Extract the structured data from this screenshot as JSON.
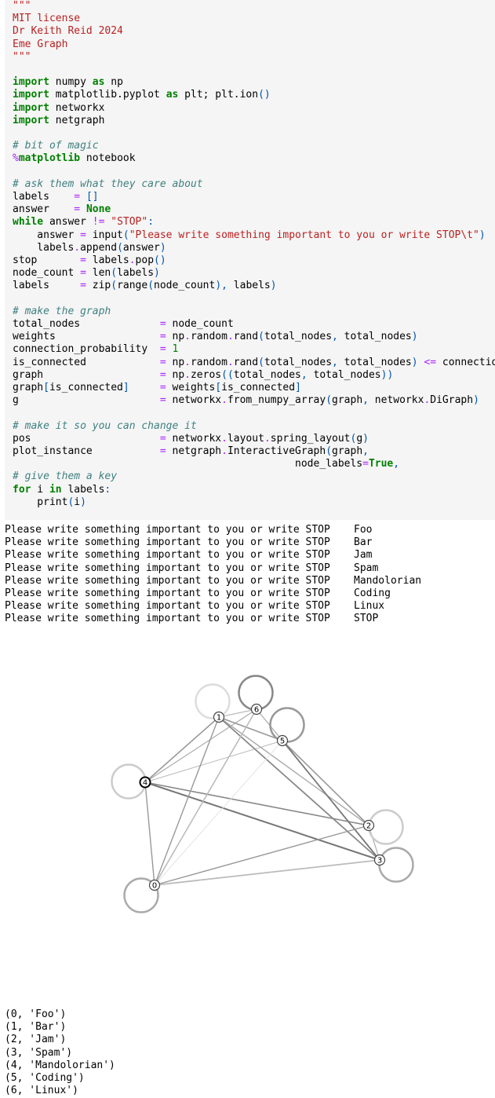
{
  "code_lines": [
    [
      {
        "t": "\"\"\"",
        "c": "str"
      }
    ],
    [
      {
        "t": "MIT license",
        "c": "str"
      }
    ],
    [
      {
        "t": "Dr Keith Reid 2024",
        "c": "str"
      }
    ],
    [
      {
        "t": "Eme Graph",
        "c": "str"
      }
    ],
    [
      {
        "t": "\"\"\"",
        "c": "str"
      }
    ],
    [],
    [
      {
        "t": "import",
        "c": "kw"
      },
      {
        "t": " numpy "
      },
      {
        "t": "as",
        "c": "kw"
      },
      {
        "t": " np"
      }
    ],
    [
      {
        "t": "import",
        "c": "kw"
      },
      {
        "t": " matplotlib.pyplot "
      },
      {
        "t": "as",
        "c": "kw"
      },
      {
        "t": " plt; plt.ion"
      },
      {
        "t": "()",
        "c": "punc"
      }
    ],
    [
      {
        "t": "import",
        "c": "kw"
      },
      {
        "t": " networkx"
      }
    ],
    [
      {
        "t": "import",
        "c": "kw"
      },
      {
        "t": " netgraph"
      }
    ],
    [],
    [
      {
        "t": "# bit of magic",
        "c": "com"
      }
    ],
    [
      {
        "t": "%",
        "c": "mag"
      },
      {
        "t": "matplotlib",
        "c": "kw"
      },
      {
        "t": " notebook"
      }
    ],
    [],
    [
      {
        "t": "# ask them what they care about",
        "c": "com"
      }
    ],
    [
      {
        "t": "labels    "
      },
      {
        "t": "=",
        "c": "op"
      },
      {
        "t": " "
      },
      {
        "t": "[]",
        "c": "punc"
      }
    ],
    [
      {
        "t": "answer    "
      },
      {
        "t": "=",
        "c": "op"
      },
      {
        "t": " "
      },
      {
        "t": "None",
        "c": "kw"
      }
    ],
    [
      {
        "t": "while",
        "c": "kw"
      },
      {
        "t": " answer "
      },
      {
        "t": "!=",
        "c": "op"
      },
      {
        "t": " "
      },
      {
        "t": "\"STOP\"",
        "c": "str"
      },
      {
        "t": ":",
        "c": "punc"
      }
    ],
    [
      {
        "t": "    answer "
      },
      {
        "t": "=",
        "c": "op"
      },
      {
        "t": " input"
      },
      {
        "t": "(",
        "c": "punc"
      },
      {
        "t": "\"Please write something important to you or write STOP\\t\"",
        "c": "str"
      },
      {
        "t": ")",
        "c": "punc"
      }
    ],
    [
      {
        "t": "    labels"
      },
      {
        "t": ".",
        "c": "op"
      },
      {
        "t": "append"
      },
      {
        "t": "(",
        "c": "punc"
      },
      {
        "t": "answer"
      },
      {
        "t": ")",
        "c": "punc"
      }
    ],
    [
      {
        "t": "stop       "
      },
      {
        "t": "=",
        "c": "op"
      },
      {
        "t": " labels"
      },
      {
        "t": ".",
        "c": "op"
      },
      {
        "t": "pop"
      },
      {
        "t": "()",
        "c": "punc"
      }
    ],
    [
      {
        "t": "node_count "
      },
      {
        "t": "=",
        "c": "op"
      },
      {
        "t": " len"
      },
      {
        "t": "(",
        "c": "punc"
      },
      {
        "t": "labels"
      },
      {
        "t": ")",
        "c": "punc"
      }
    ],
    [
      {
        "t": "labels     "
      },
      {
        "t": "=",
        "c": "op"
      },
      {
        "t": " zip"
      },
      {
        "t": "(",
        "c": "punc"
      },
      {
        "t": "range"
      },
      {
        "t": "(",
        "c": "punc"
      },
      {
        "t": "node_count"
      },
      {
        "t": "),",
        "c": "punc"
      },
      {
        "t": " labels"
      },
      {
        "t": ")",
        "c": "punc"
      }
    ],
    [],
    [
      {
        "t": "# make the graph",
        "c": "com"
      }
    ],
    [
      {
        "t": "total_nodes             "
      },
      {
        "t": "=",
        "c": "op"
      },
      {
        "t": " node_count"
      }
    ],
    [
      {
        "t": "weights                 "
      },
      {
        "t": "=",
        "c": "op"
      },
      {
        "t": " np"
      },
      {
        "t": ".",
        "c": "op"
      },
      {
        "t": "random"
      },
      {
        "t": ".",
        "c": "op"
      },
      {
        "t": "rand"
      },
      {
        "t": "(",
        "c": "punc"
      },
      {
        "t": "total_nodes"
      },
      {
        "t": ",",
        "c": "punc"
      },
      {
        "t": " total_nodes"
      },
      {
        "t": ")",
        "c": "punc"
      }
    ],
    [
      {
        "t": "connection_probability  "
      },
      {
        "t": "=",
        "c": "op"
      },
      {
        "t": " "
      },
      {
        "t": "1",
        "c": "num"
      }
    ],
    [
      {
        "t": "is_connected            "
      },
      {
        "t": "=",
        "c": "op"
      },
      {
        "t": " np"
      },
      {
        "t": ".",
        "c": "op"
      },
      {
        "t": "random"
      },
      {
        "t": ".",
        "c": "op"
      },
      {
        "t": "rand"
      },
      {
        "t": "(",
        "c": "punc"
      },
      {
        "t": "total_nodes"
      },
      {
        "t": ",",
        "c": "punc"
      },
      {
        "t": " total_nodes"
      },
      {
        "t": ")",
        "c": "punc"
      },
      {
        "t": " "
      },
      {
        "t": "<=",
        "c": "op"
      },
      {
        "t": " connection_probability"
      }
    ],
    [
      {
        "t": "graph                   "
      },
      {
        "t": "=",
        "c": "op"
      },
      {
        "t": " np"
      },
      {
        "t": ".",
        "c": "op"
      },
      {
        "t": "zeros"
      },
      {
        "t": "((",
        "c": "punc"
      },
      {
        "t": "total_nodes"
      },
      {
        "t": ",",
        "c": "punc"
      },
      {
        "t": " total_nodes"
      },
      {
        "t": "))",
        "c": "punc"
      }
    ],
    [
      {
        "t": "graph"
      },
      {
        "t": "[",
        "c": "punc"
      },
      {
        "t": "is_connected"
      },
      {
        "t": "]",
        "c": "punc"
      },
      {
        "t": "     "
      },
      {
        "t": "=",
        "c": "op"
      },
      {
        "t": " weights"
      },
      {
        "t": "[",
        "c": "punc"
      },
      {
        "t": "is_connected"
      },
      {
        "t": "]",
        "c": "punc"
      }
    ],
    [
      {
        "t": "g                       "
      },
      {
        "t": "=",
        "c": "op"
      },
      {
        "t": " networkx"
      },
      {
        "t": ".",
        "c": "op"
      },
      {
        "t": "from_numpy_array"
      },
      {
        "t": "(",
        "c": "punc"
      },
      {
        "t": "graph"
      },
      {
        "t": ",",
        "c": "punc"
      },
      {
        "t": " networkx"
      },
      {
        "t": ".",
        "c": "op"
      },
      {
        "t": "DiGraph"
      },
      {
        "t": ")",
        "c": "punc"
      }
    ],
    [],
    [
      {
        "t": "# make it so you can change it",
        "c": "com"
      }
    ],
    [
      {
        "t": "pos                     "
      },
      {
        "t": "=",
        "c": "op"
      },
      {
        "t": " networkx"
      },
      {
        "t": ".",
        "c": "op"
      },
      {
        "t": "layout"
      },
      {
        "t": ".",
        "c": "op"
      },
      {
        "t": "spring_layout"
      },
      {
        "t": "(",
        "c": "punc"
      },
      {
        "t": "g"
      },
      {
        "t": ")",
        "c": "punc"
      }
    ],
    [
      {
        "t": "plot_instance           "
      },
      {
        "t": "=",
        "c": "op"
      },
      {
        "t": " netgraph"
      },
      {
        "t": ".",
        "c": "op"
      },
      {
        "t": "InteractiveGraph"
      },
      {
        "t": "(",
        "c": "punc"
      },
      {
        "t": "graph"
      },
      {
        "t": ",",
        "c": "punc"
      }
    ],
    [
      {
        "t": "                                              node_labels"
      },
      {
        "t": "=",
        "c": "op"
      },
      {
        "t": "True",
        "c": "kw"
      },
      {
        "t": ",",
        "c": "punc"
      }
    ],
    [
      {
        "t": "# give them a key",
        "c": "com"
      }
    ],
    [
      {
        "t": "for",
        "c": "kw"
      },
      {
        "t": " i "
      },
      {
        "t": "in",
        "c": "kw"
      },
      {
        "t": " labels"
      },
      {
        "t": ":",
        "c": "punc"
      }
    ],
    [
      {
        "t": "    print"
      },
      {
        "t": "(",
        "c": "punc"
      },
      {
        "t": "i"
      },
      {
        "t": ")",
        "c": "punc"
      }
    ]
  ],
  "input_prompts": {
    "prompt": "Please write something important to you or write STOP",
    "answers": [
      "Foo",
      "Bar",
      "Jam",
      "Spam",
      "Mandolorian",
      "Coding",
      "Linux",
      "STOP"
    ]
  },
  "graph": {
    "nodes": [
      {
        "label": "0"
      },
      {
        "label": "1"
      },
      {
        "label": "2"
      },
      {
        "label": "3"
      },
      {
        "label": "4"
      },
      {
        "label": "5"
      },
      {
        "label": "6"
      }
    ]
  },
  "printed_output": [
    "(0, 'Foo')",
    "(1, 'Bar')",
    "(2, 'Jam')",
    "(3, 'Spam')",
    "(4, 'Mandolorian')",
    "(5, 'Coding')",
    "(6, 'Linux')"
  ]
}
